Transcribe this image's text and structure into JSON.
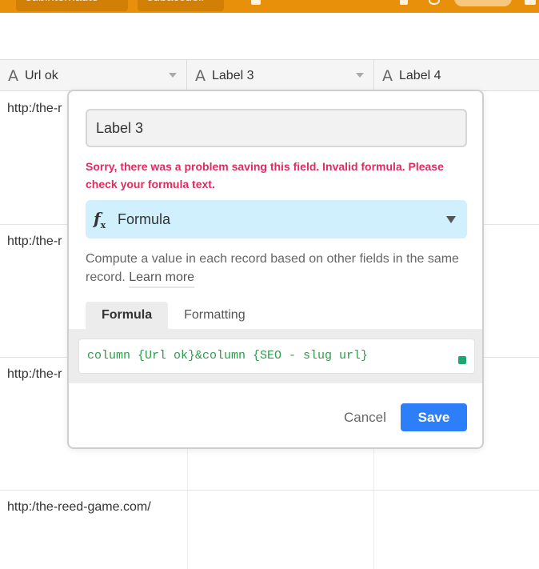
{
  "topbar": {
    "tabs": [
      "subinternaute",
      "subaccueil"
    ],
    "share_label": "SHARE"
  },
  "grid": {
    "columns": [
      {
        "label": "Url ok",
        "type_icon": "A"
      },
      {
        "label": "Label 3",
        "type_icon": "A"
      },
      {
        "label": "Label 4",
        "type_icon": "A"
      }
    ],
    "rows": [
      {
        "url": "http:/the-r"
      },
      {
        "url": "http:/the-r"
      },
      {
        "url": "http:/the-r"
      },
      {
        "url": "http:/the-reed-game.com/"
      }
    ]
  },
  "dialog": {
    "field_name": "Label 3",
    "error": "Sorry, there was a problem saving this field. Invalid formula. Please check your formula text.",
    "field_type": "Formula",
    "field_type_icon": "formula-icon",
    "description": "Compute a value in each record based on other fields in the same record.",
    "learn_more": "Learn more",
    "tabs": [
      "Formula",
      "Formatting"
    ],
    "active_tab": "Formula",
    "formula_text": "column {Url ok}&column {SEO - slug url}",
    "cancel_label": "Cancel",
    "save_label": "Save"
  },
  "colors": {
    "topbar": "#e8900a",
    "error": "#e02b5f",
    "type_select_bg": "#d0f0fd",
    "save_button": "#2d7ff9",
    "formula_text": "#2d9c4b"
  }
}
